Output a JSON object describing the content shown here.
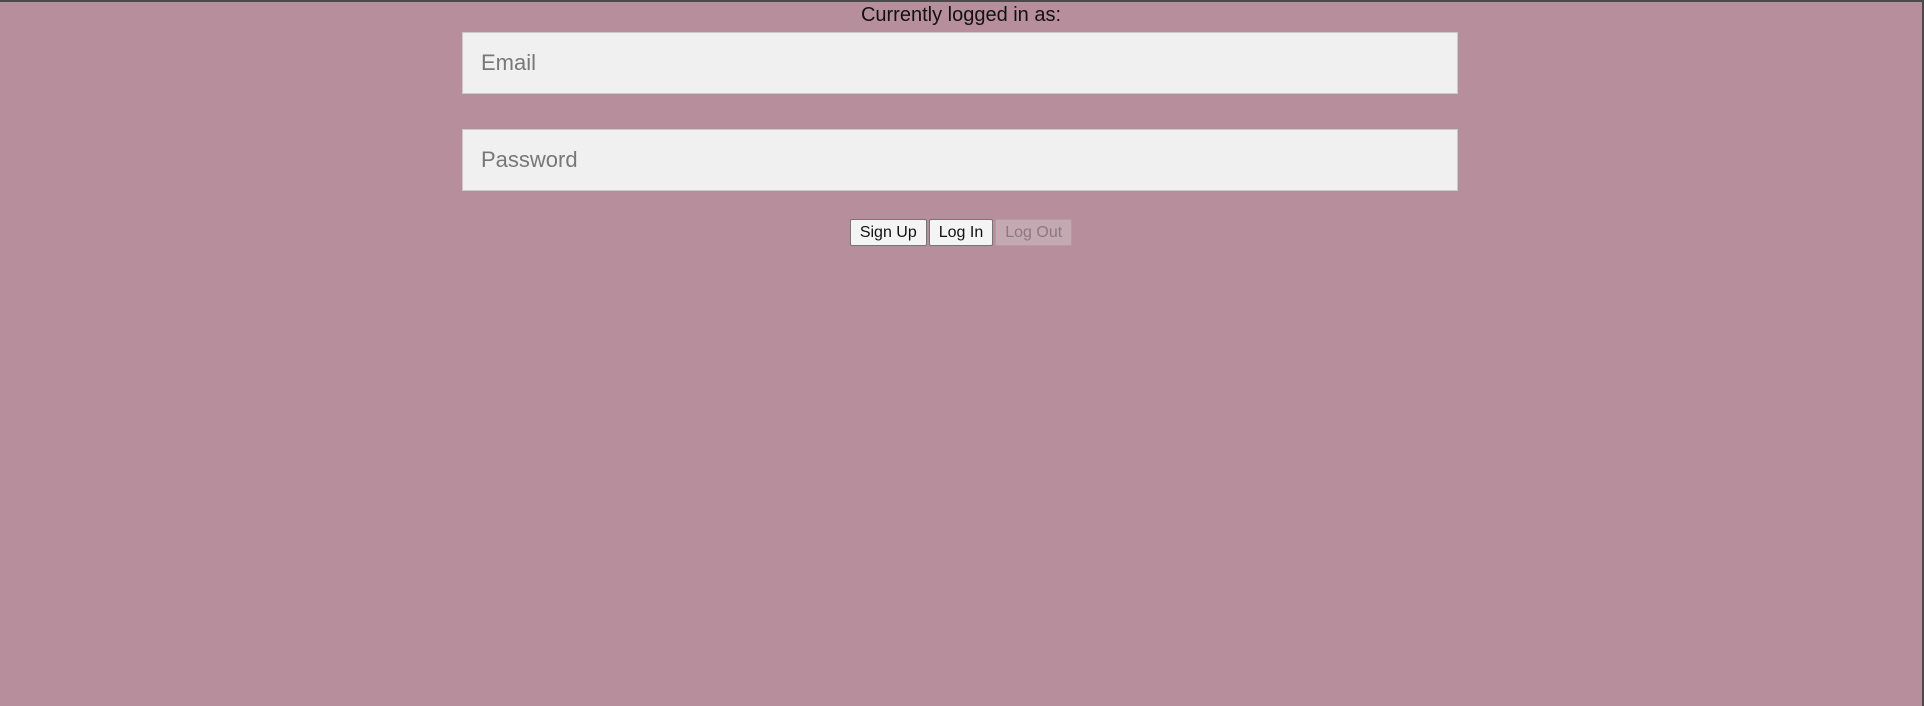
{
  "status": {
    "text": "Currently logged in as:"
  },
  "form": {
    "email_placeholder": "Email",
    "email_value": "",
    "password_placeholder": "Password",
    "password_value": ""
  },
  "buttons": {
    "signup_label": "Sign Up",
    "login_label": "Log In",
    "logout_label": "Log Out",
    "logout_disabled": true
  },
  "colors": {
    "background": "#b78f9c",
    "field_background": "#f0f0f0"
  }
}
